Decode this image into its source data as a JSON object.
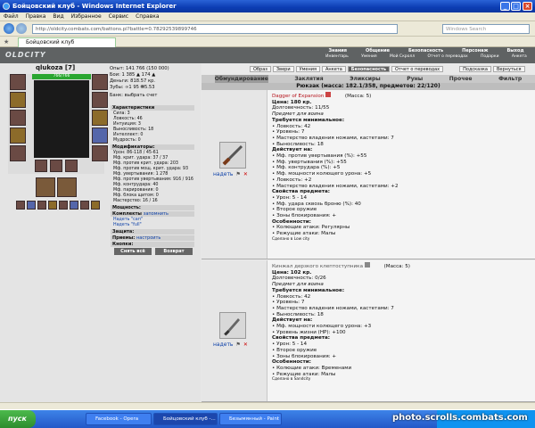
{
  "window": {
    "title": "Бойцовский клуб - Windows Internet Explorer"
  },
  "menubar": [
    "Файл",
    "Правка",
    "Вид",
    "Избранное",
    "Сервис",
    "Справка"
  ],
  "browser": {
    "address": "http://oldcity.combats.com/battons.pl?battle=0.78292539899746",
    "search_placeholder": "Windows Search",
    "tab_label": "Бойцовский клуб"
  },
  "game": {
    "logo": "OLDCITY",
    "topmenu_row1": [
      "Знания",
      "Общение",
      "Безопасность",
      "Персонаж",
      "Выход"
    ],
    "topmenu_row2": [
      "Инвентарь",
      "Умения",
      "Мой Скролл",
      "Отчет о переводах",
      "Подарки",
      "Анкета"
    ]
  },
  "character": {
    "nick": "qlukoza [7]",
    "hp": "766/766",
    "stats": [
      "Опыт: 141 766 (150 000)",
      "Бои: 1 385 ▲ 174 ▲",
      "Деньги: 818.57 кр.",
      "Зубы: ∞1 95 ⛃5.53"
    ],
    "bank": "Банк: выбрать счет",
    "chars_header": "Характеристики",
    "chars": [
      "Сила: 3",
      "Ловкость: 46",
      "Интуиция: 3",
      "Выносливость: 18",
      "Интеллект: 0",
      "Мудрость: 0"
    ],
    "mods_header": "Модификаторы:",
    "mods": [
      "Урон: 86-118 / 45-61",
      "Мф. крит. удара: 37 / 37",
      "Мф. против крит. удара: 203",
      "Мф. против мощ. крит. удара: 93",
      "Мф. увертывания: 1 278",
      "Мф. против увертывания: 916 / 916",
      "Мф. контрудара: 40",
      "Мф. парирования: 0",
      "Мф. блока щитом: 0",
      "Мастерство: 16 / 16"
    ],
    "mastery_header": "Мощность:",
    "sets_header": "Комплекты",
    "sets_link": "запомнить",
    "sets": [
      "Надеть \"сап\"",
      "Надеть \"full\""
    ],
    "defense_header": "Защита:",
    "tricks_header": "Приемы:",
    "tricks_link": "настроить",
    "buttons_header": "Кнопки:",
    "btn_undress": "Снять всё",
    "btn_return": "Возврат"
  },
  "subnav": [
    "Образ",
    "Звери",
    "Умения",
    "Анкета",
    "Безопасность",
    "Отчет о переводах",
    "Подсказка",
    "Вернуться"
  ],
  "invtabs": [
    "Обмундирование",
    "Заклятия",
    "Эликсиры",
    "Руны",
    "Прочее",
    "Фильтр"
  ],
  "backpack": "Рюкзак (масса: 182.1/358, предметов: 22/120)",
  "dress_label": "надеть",
  "item1": {
    "name": "Dagger of Expansion",
    "mass": "(Масса: 5)",
    "lines": [
      {
        "t": "Цена: 180 кр.",
        "s": "b"
      },
      {
        "t": "Долговечность: 11/55",
        "s": ""
      },
      {
        "t": "Предмет для воина",
        "s": "i"
      },
      {
        "t": "Требуется минимальное:",
        "s": "b"
      },
      {
        "t": "• Ловкость: 42",
        "s": ""
      },
      {
        "t": "• Уровень: 7",
        "s": ""
      },
      {
        "t": "• Мастерство владения ножами, кастетами: 7",
        "s": ""
      },
      {
        "t": "• Выносливость: 18",
        "s": ""
      },
      {
        "t": "Действует на:",
        "s": "b"
      },
      {
        "t": "• Мф. против увертывания (%): +55",
        "s": ""
      },
      {
        "t": "• Мф. увертывания (%): +55",
        "s": ""
      },
      {
        "t": "• Мф. контрудара (%): +5",
        "s": ""
      },
      {
        "t": "• Мф. мощности колющего урона: +5",
        "s": ""
      },
      {
        "t": "• Ловкость: +2",
        "s": ""
      },
      {
        "t": "• Мастерство владения ножами, кастетами: +2",
        "s": ""
      },
      {
        "t": "Свойства предмета:",
        "s": "b"
      },
      {
        "t": "• Урон: 5 - 14",
        "s": ""
      },
      {
        "t": "• Мф. удара сквозь броню (%): 40",
        "s": ""
      },
      {
        "t": "• Второе оружие",
        "s": ""
      },
      {
        "t": "• Зоны блокирования: +",
        "s": ""
      },
      {
        "t": "Особенности:",
        "s": "b"
      },
      {
        "t": "• Колющие атаки: Регулярны",
        "s": ""
      },
      {
        "t": "• Режущие атаки: Малы",
        "s": ""
      },
      {
        "t": "Сделано в Low city",
        "s": "sm"
      }
    ]
  },
  "item2": {
    "name": "Кинжал дерзкого клептоступника",
    "mass": "(Масса: 5)",
    "lines": [
      {
        "t": "Цена: 102 кр.",
        "s": "b"
      },
      {
        "t": "Долговечность: 0/26",
        "s": ""
      },
      {
        "t": "Предмет для воина",
        "s": "i"
      },
      {
        "t": "Требуется минимальное:",
        "s": "b"
      },
      {
        "t": "• Ловкость: 42",
        "s": ""
      },
      {
        "t": "• Уровень: 7",
        "s": ""
      },
      {
        "t": "• Мастерство владения ножами, кастетами: 7",
        "s": ""
      },
      {
        "t": "• Выносливость: 18",
        "s": ""
      },
      {
        "t": "Действует на:",
        "s": "b"
      },
      {
        "t": "• Мф. мощности колющего урона: +3",
        "s": ""
      },
      {
        "t": "• Уровень жизни (HP): +100",
        "s": ""
      },
      {
        "t": "Свойства предмета:",
        "s": "b"
      },
      {
        "t": "• Урон: 5 - 14",
        "s": ""
      },
      {
        "t": "• Второе оружие",
        "s": ""
      },
      {
        "t": "• Зоны блокирования: +",
        "s": ""
      },
      {
        "t": "Особенности:",
        "s": "b"
      },
      {
        "t": "• Колющие атаки: Временами",
        "s": ""
      },
      {
        "t": "• Режущие атаки: Малы",
        "s": ""
      },
      {
        "t": "Сделано в Sandcity",
        "s": "sm"
      }
    ]
  },
  "taskbar": {
    "start": "пуск",
    "buttons": [
      "Facebook - Opera",
      "Бойцовский клуб -...",
      "Безымянный - Paint"
    ],
    "watermark": "photo.scrolls.combats.com"
  }
}
